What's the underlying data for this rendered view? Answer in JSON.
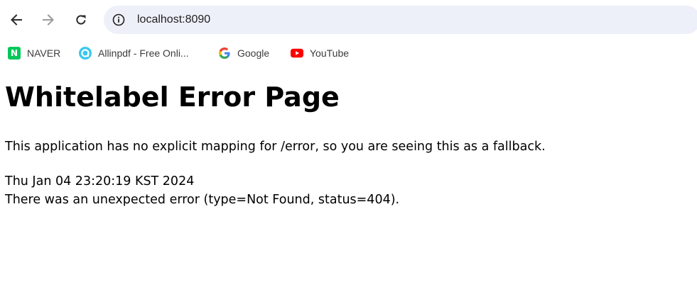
{
  "browser": {
    "url": "localhost:8090",
    "bookmarks": [
      {
        "label": "NAVER",
        "icon": "naver-icon"
      },
      {
        "label": "Allinpdf - Free Onli...",
        "icon": "allinpdf-icon"
      },
      {
        "label": "Google",
        "icon": "google-icon"
      },
      {
        "label": "YouTube",
        "icon": "youtube-icon"
      }
    ],
    "naver_letter": "N"
  },
  "page": {
    "title": "Whitelabel Error Page",
    "message": "This application has no explicit mapping for /error, so you are seeing this as a fallback.",
    "timestamp": "Thu Jan 04 23:20:19 KST 2024",
    "error_detail": "There was an unexpected error (type=Not Found, status=404)."
  },
  "colors": {
    "omnibox_bg": "#eef0f9",
    "naver_green": "#03c75a",
    "youtube_red": "#ff0000"
  }
}
